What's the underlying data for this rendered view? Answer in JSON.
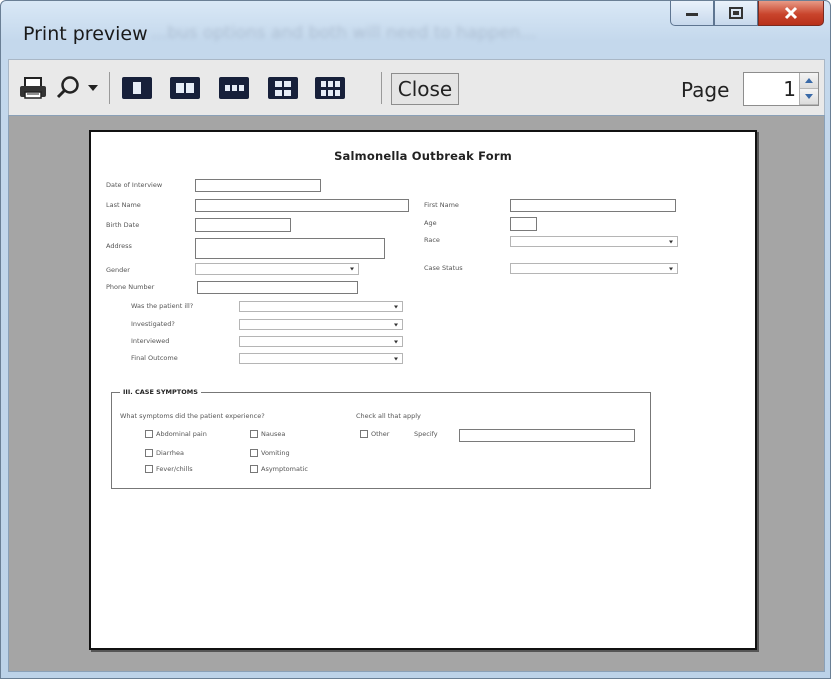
{
  "window": {
    "title": "Print preview",
    "background_text": "...bus options and both will need to happen...",
    "minimize_icon": "minimize-icon",
    "maximize_icon": "maximize-icon",
    "close_icon": "close-icon"
  },
  "toolbar": {
    "print_icon": "printer-icon",
    "zoom_icon": "magnifier-icon",
    "zoom_dropdown_icon": "dropdown-arrow-icon",
    "layouts": [
      "one-page-icon",
      "two-pages-icon",
      "three-pages-icon",
      "four-pages-icon",
      "six-pages-icon"
    ],
    "close_label": "Close",
    "page_label": "Page",
    "page_value": "1"
  },
  "form": {
    "title": "Salmonella Outbreak Form",
    "labels": {
      "date_of_interview": "Date of Interview",
      "last_name": "Last Name",
      "birth_date": "Birth Date",
      "address": "Address",
      "gender": "Gender",
      "phone_number": "Phone Number",
      "was_ill": "Was the patient ill?",
      "investigated": "Investigated?",
      "interviewed": "Interviewed",
      "final_outcome": "Final Outcome",
      "first_name": "First Name",
      "age": "Age",
      "race": "Race",
      "case_status": "Case Status"
    },
    "symptoms": {
      "section_title": "III. CASE SYMPTOMS",
      "question": "What symptoms did the patient experience?",
      "check_all": "Check all that apply",
      "specify": "Specify",
      "options": [
        "Abdominal pain",
        "Nausea",
        "Diarrhea",
        "Vomiting",
        "Fever/chills",
        "Asymptomatic",
        "Other"
      ]
    }
  },
  "colors": {
    "title_bar": "#c4d8ec",
    "close_button": "#c9442c",
    "viewport_bg": "#a5a5a5",
    "paper": "#ffffff"
  }
}
